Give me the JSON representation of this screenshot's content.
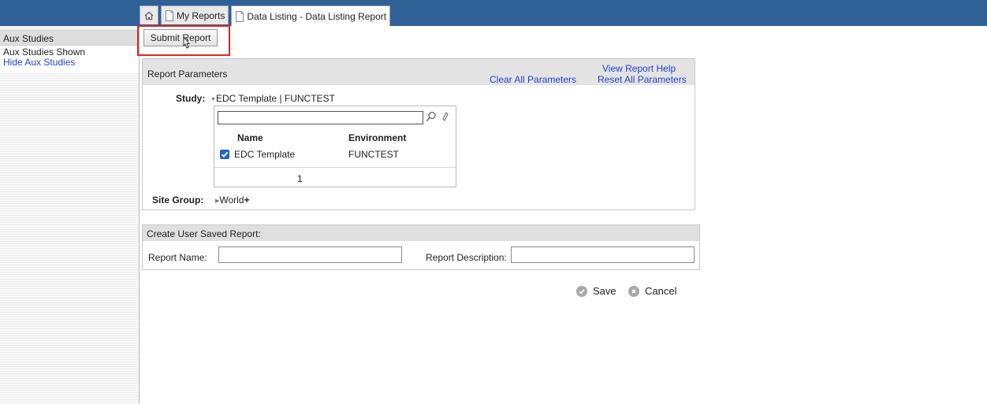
{
  "tabs": [
    {
      "icon": "home-icon",
      "label": ""
    },
    {
      "icon": "document-icon",
      "label": "My Reports"
    },
    {
      "icon": "document-icon",
      "label": "Data Listing - Data Listing Report"
    }
  ],
  "sidebar": {
    "header": "Aux Studies",
    "status": "Aux Studies Shown",
    "hide_link": "Hide Aux Studies"
  },
  "toolbar": {
    "submit_label": "Submit Report"
  },
  "params": {
    "title": "Report Parameters",
    "help_link": "View Report Help",
    "clear_link": "Clear All Parameters",
    "reset_link": "Reset All Parameters",
    "study_label": "Study:",
    "study_value": "EDC Template | FUNCTEST",
    "search_value": "",
    "columns": [
      "Name",
      "Environment"
    ],
    "rows": [
      {
        "checked": true,
        "name": "EDC Template",
        "environment": "FUNCTEST"
      }
    ],
    "page": "1",
    "site_group_label": "Site Group:",
    "site_group_value": "World"
  },
  "saved": {
    "title": "Create User Saved Report:",
    "name_label": "Report Name:",
    "name_value": "",
    "desc_label": "Report Description:",
    "desc_value": ""
  },
  "actions": {
    "save": "Save",
    "cancel": "Cancel"
  },
  "colors": {
    "topbar": "#2f6197",
    "link": "#2244cc",
    "highlight": "#e0221f",
    "checkbox": "#2563c8"
  }
}
